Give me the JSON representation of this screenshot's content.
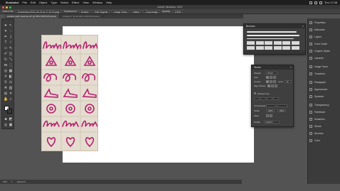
{
  "menubar": {
    "app": "Illustrator",
    "items": [
      "File",
      "Edit",
      "Object",
      "Type",
      "Select",
      "Effect",
      "View",
      "Window",
      "Help"
    ],
    "clock": "Thu 17:38"
  },
  "window": {
    "title": "Adobe Illustrator 2021"
  },
  "controlbar": {
    "selection": "Linked File",
    "file": "Screenshot 2021-04-22 at 17.22.03.png",
    "transformed": "Transformed",
    "embed": "Embed",
    "edit_original": "Edit Original",
    "image_trace": "Image Trace",
    "mask": "Mask",
    "crop_image": "Crop Image",
    "opacity_label": "Opacity:",
    "opacity": "100%"
  },
  "doctabs": [
    {
      "label": "shadow stitch sketches.ai* @ 35% (CMYK/Preview)",
      "active": true
    },
    {
      "label": "Untitled-1* @ 26.93% (CMYK/Preview)",
      "active": false
    }
  ],
  "statusbar": {
    "zoom": "35%",
    "artboard": "1",
    "info": "Selection"
  },
  "rightdock": {
    "items": [
      "Properties",
      "Artboards",
      "Layers",
      "Color Guide",
      "Graphic Styles",
      "Libraries",
      "Image Trace",
      "Transform",
      "Paragraph",
      "Appearance",
      "Symbols",
      "Transparency",
      "Pathfinder",
      "Swatches",
      "Stroke",
      "Brushes",
      "Color"
    ]
  },
  "brushes_panel": {
    "title": "Brushes"
  },
  "stroke_panel": {
    "title": "Stroke",
    "weight_label": "Weight:",
    "weight": "0.5 pt",
    "cap_label": "Cap:",
    "corner_label": "Corner:",
    "limit_label": "Limit:",
    "limit": "10",
    "align_label": "Align Stroke:",
    "dashed_label": "Dashed Line",
    "arrowheads_label": "Arrowheads:",
    "scale_label": "Scale:",
    "scale_start": "100%",
    "scale_end": "100%",
    "align_tip_label": "Align:",
    "profile_label": "Profile:",
    "profile": "Uniform"
  },
  "colors": {
    "stitch": "#b5216e",
    "fabric": "#e4dccf",
    "accent": "#2d6fd6"
  }
}
